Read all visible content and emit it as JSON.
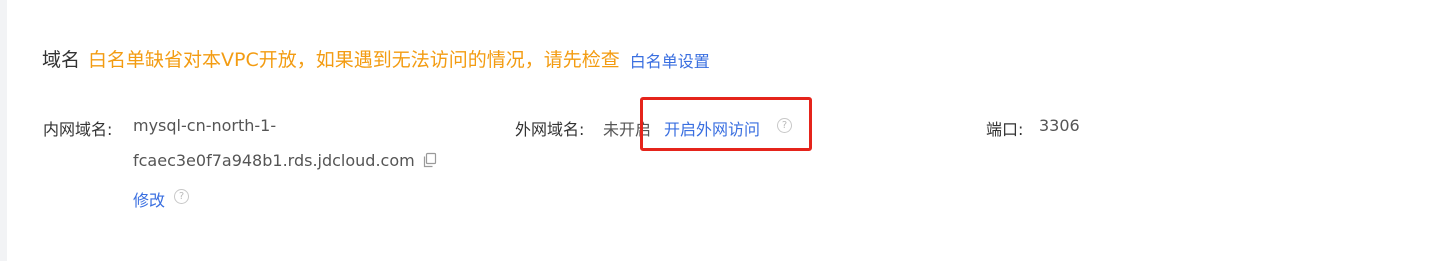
{
  "domain_section": {
    "title": "域名",
    "notice": "白名单缺省对本VPC开放，如果遇到无法访问的情况，请先检查",
    "whitelist_link": "白名单设置"
  },
  "internal_domain": {
    "label": "内网域名:",
    "value_line1": "mysql-cn-north-1-",
    "value_line2": "fcaec3e0f7a948b1.rds.jdcloud.com",
    "modify_link": "修改"
  },
  "external_domain": {
    "label": "外网域名:",
    "status": "未开启",
    "enable_link": "开启外网访问"
  },
  "port": {
    "label": "端口:",
    "value": "3306"
  },
  "icons": {
    "copy": "copy-icon",
    "help": "question-circle-icon"
  },
  "colors": {
    "notice": "#f39c12",
    "link": "#3a6fe0",
    "highlight": "#e5241b"
  }
}
